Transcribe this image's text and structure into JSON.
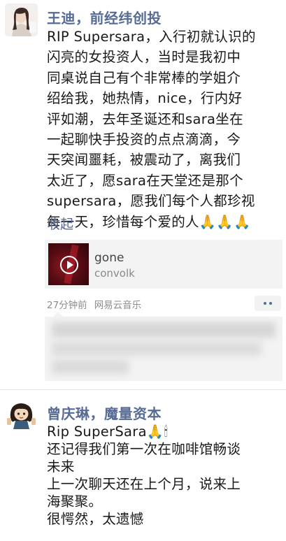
{
  "posts": [
    {
      "name": "王迪，前经纬创投",
      "lines": [
        "RIP Supersara，入行初就认识的",
        "闪亮的女投资人，当时是我初中",
        "同桌说自己有个非常棒的学姐介",
        "绍给我，她热情，nice，行内好",
        "评如潮，去年圣诞还和sara坐在",
        "一起聊快手投资的点点滴滴，今",
        "天突闻噩耗，被震动了，离我们",
        "太近了，愿sara在天堂还是那个",
        "supersara，愿我们每个人都珍视",
        "每一天，珍惜每个爱的人🙏🙏🙏"
      ],
      "collapse_label": "收起",
      "music": {
        "title": "gone",
        "artist": "convolk",
        "cover_icon": "play-icon"
      },
      "time": "27分钟前",
      "source": "网易云音乐",
      "more_icon": "more-dots-icon"
    },
    {
      "name": "曾庆琳，魔量资本",
      "lines": [
        "Rip SuperSara🙏🕯",
        "还记得我们第一次在咖啡馆畅谈",
        "未来",
        "上一次聊天还在上个月，说来上",
        "海聚聚。",
        "很愕然，太遗憾"
      ]
    }
  ],
  "colors": {
    "name_link": "#576b95",
    "text": "#191919",
    "meta": "#8c8c8c",
    "card_bg": "#f3f3f3"
  }
}
